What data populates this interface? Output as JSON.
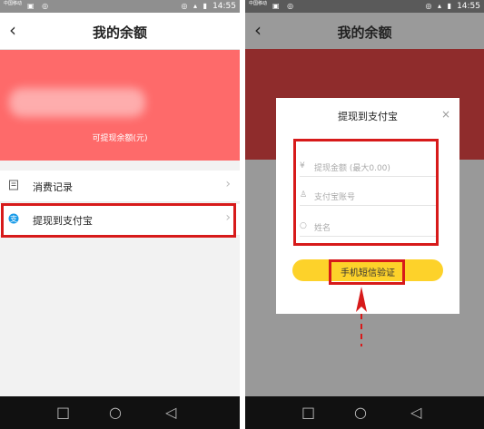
{
  "status_bar": {
    "carrier": "中国移动",
    "time": "14:55"
  },
  "header": {
    "back_symbol": "‹",
    "title": "我的余额"
  },
  "balance": {
    "label": "可提现余额(元)"
  },
  "menu": {
    "items": [
      {
        "label": "消费记录",
        "icon": "receipt-icon"
      },
      {
        "label": "提现到支付宝",
        "icon": "alipay-icon"
      }
    ],
    "chevron": "›"
  },
  "dialog": {
    "title": "提现到支付宝",
    "close": "×",
    "fields": {
      "amount": {
        "placeholder": "提现金额 (最大0.00)"
      },
      "account": {
        "placeholder": "支付宝账号"
      },
      "name": {
        "placeholder": "姓名"
      }
    },
    "button": "手机短信验证"
  },
  "navbar": {
    "square": "□",
    "circle": "○",
    "back": "◁"
  },
  "colors": {
    "banner": "#fe6a6a",
    "highlight": "#d71a1a",
    "button": "#fdd22a"
  }
}
